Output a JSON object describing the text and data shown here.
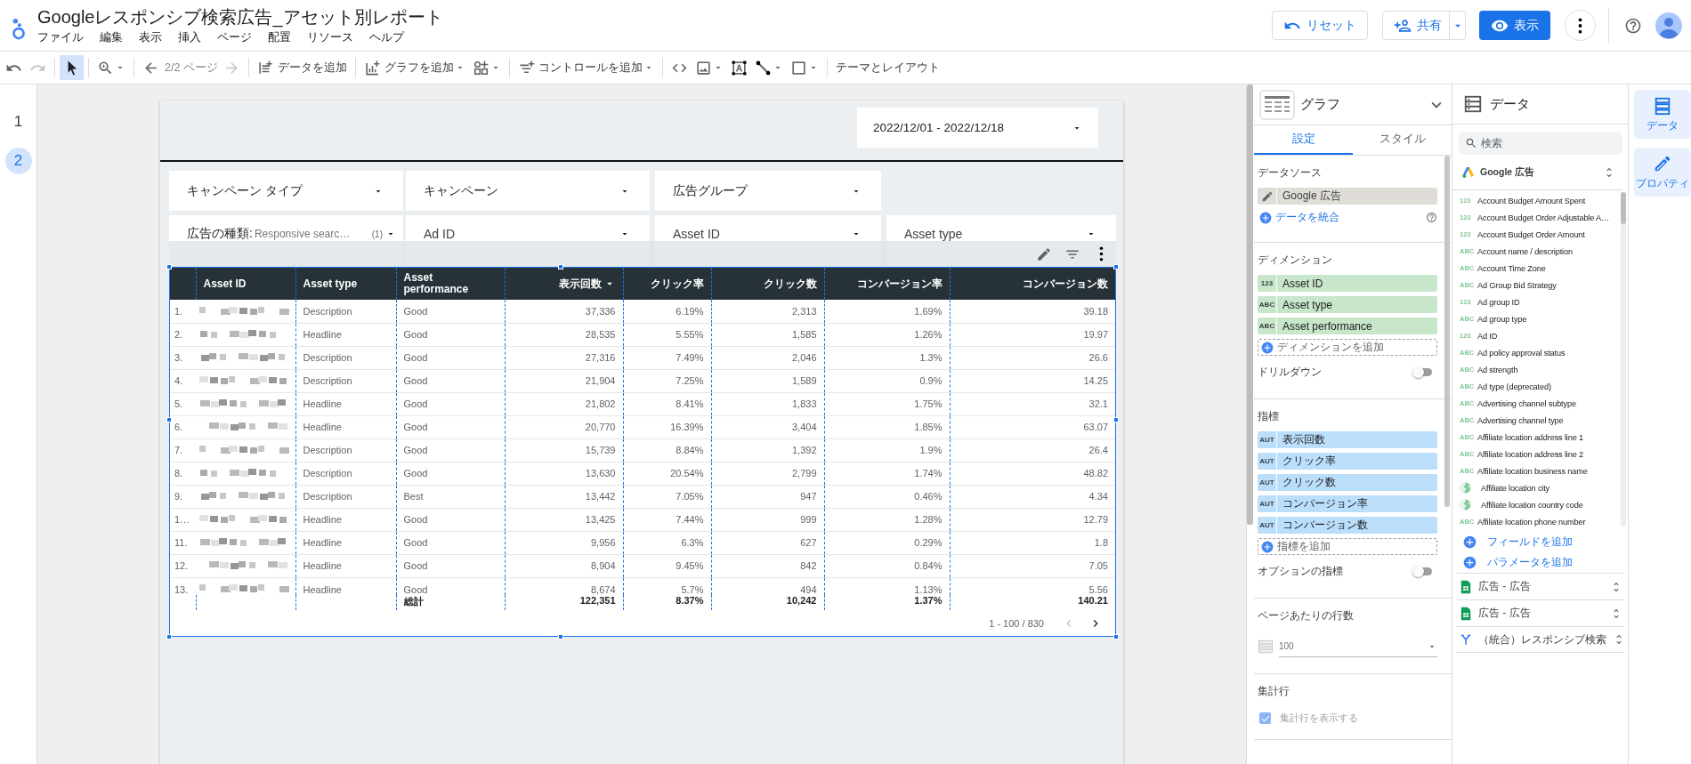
{
  "header": {
    "title": "Googleレスポンシブ検索広告_アセット別レポート",
    "menus": [
      "ファイル",
      "編集",
      "表示",
      "挿入",
      "ページ",
      "配置",
      "リソース",
      "ヘルプ"
    ],
    "reset": "リセット",
    "share": "共有",
    "view": "表示"
  },
  "toolbar": {
    "groups": [
      [
        {
          "kind": "undo",
          "selected": false
        },
        {
          "kind": "redo",
          "selected": false,
          "disabled": true
        }
      ],
      [
        {
          "kind": "select",
          "selected": true
        }
      ],
      [
        {
          "kind": "zoom",
          "selected": false,
          "dropdown": true
        }
      ],
      [
        {
          "kind": "back",
          "selected": false
        },
        {
          "kind": "page",
          "label": "2/2 ページ",
          "selected": false,
          "disabled": true
        },
        {
          "kind": "forward",
          "selected": false,
          "disabled": true
        }
      ],
      [
        {
          "kind": "add_data",
          "label": "データを追加",
          "selected": false
        }
      ],
      [
        {
          "kind": "add_chart",
          "label": "グラフを追加",
          "selected": false,
          "dropdown": true
        },
        {
          "kind": "component",
          "selected": false,
          "dropdown": true
        }
      ],
      [
        {
          "kind": "add_control",
          "label": "コントロールを追加",
          "selected": false,
          "dropdown": true
        }
      ],
      [
        {
          "kind": "code",
          "selected": false
        },
        {
          "kind": "image",
          "selected": false,
          "dropdown": true
        },
        {
          "kind": "textbox",
          "selected": false
        },
        {
          "kind": "line",
          "selected": false,
          "dropdown": true
        },
        {
          "kind": "shape",
          "selected": false,
          "dropdown": true
        }
      ],
      [
        {
          "kind": "theme",
          "label": "テーマとレイアウト",
          "selected": false
        }
      ]
    ]
  },
  "pages": [
    {
      "label": "1",
      "selected": false
    },
    {
      "label": "2",
      "selected": true
    }
  ],
  "report": {
    "date_range": "2022/12/01 - 2022/12/18",
    "filters": [
      [
        {
          "label": "キャンペーン タイプ"
        },
        {
          "label": "キャンペーン"
        },
        {
          "label": "広告グループ"
        }
      ],
      [
        {
          "label": "広告の種類:",
          "value": "Responsive searc…",
          "count": "(1)"
        },
        {
          "label": "Ad ID"
        },
        {
          "label": "Asset ID"
        },
        {
          "label": "Asset type"
        }
      ]
    ],
    "table": {
      "columns": [
        {
          "label": "Asset ID",
          "kind": "dimension",
          "sorted": false
        },
        {
          "label": "Asset type",
          "kind": "dimension",
          "sorted": false
        },
        {
          "label": "Asset performance",
          "kind": "dimension",
          "sorted": false
        },
        {
          "label": "表示回数",
          "kind": "metric",
          "sorted": true
        },
        {
          "label": "クリック率",
          "kind": "metric",
          "sorted": false
        },
        {
          "label": "クリック数",
          "kind": "metric",
          "sorted": false
        },
        {
          "label": "コンバージョン率",
          "kind": "metric",
          "sorted": false
        },
        {
          "label": "コンバージョン数",
          "kind": "metric",
          "sorted": false
        }
      ],
      "rows": [
        {
          "number": "1.",
          "cells": [
            null,
            "Description",
            "Good",
            "37,336",
            "6.19%",
            "2,313",
            "1.69%",
            "39.18"
          ]
        },
        {
          "number": "2.",
          "cells": [
            null,
            "Headline",
            "Good",
            "28,535",
            "5.55%",
            "1,585",
            "1.26%",
            "19.97"
          ]
        },
        {
          "number": "3.",
          "cells": [
            null,
            "Description",
            "Good",
            "27,316",
            "7.49%",
            "2,046",
            "1.3%",
            "26.6"
          ]
        },
        {
          "number": "4.",
          "cells": [
            null,
            "Description",
            "Good",
            "21,904",
            "7.25%",
            "1,589",
            "0.9%",
            "14.25"
          ]
        },
        {
          "number": "5.",
          "cells": [
            null,
            "Headline",
            "Good",
            "21,802",
            "8.41%",
            "1,833",
            "1.75%",
            "32.1"
          ]
        },
        {
          "number": "6.",
          "cells": [
            null,
            "Headline",
            "Good",
            "20,770",
            "16.39%",
            "3,404",
            "1.85%",
            "63.07"
          ]
        },
        {
          "number": "7.",
          "cells": [
            null,
            "Description",
            "Good",
            "15,739",
            "8.84%",
            "1,392",
            "1.9%",
            "26.4"
          ]
        },
        {
          "number": "8.",
          "cells": [
            null,
            "Description",
            "Good",
            "13,630",
            "20.54%",
            "2,799",
            "1.74%",
            "48.82"
          ]
        },
        {
          "number": "9.",
          "cells": [
            null,
            "Description",
            "Best",
            "13,442",
            "7.05%",
            "947",
            "0.46%",
            "4.34"
          ]
        },
        {
          "number": "1…",
          "cells": [
            null,
            "Headline",
            "Good",
            "13,425",
            "7.44%",
            "999",
            "1.28%",
            "12.79"
          ]
        },
        {
          "number": "11.",
          "cells": [
            null,
            "Headline",
            "Good",
            "9,956",
            "6.3%",
            "627",
            "0.29%",
            "1.8"
          ]
        },
        {
          "number": "12.",
          "cells": [
            null,
            "Headline",
            "Good",
            "8,904",
            "9.45%",
            "842",
            "0.84%",
            "7.05"
          ]
        },
        {
          "number": "13.",
          "cells": [
            null,
            "Headline",
            "Good",
            "8,674",
            "5.7%",
            "494",
            "1.13%",
            "5.56"
          ]
        }
      ],
      "totals": {
        "label": "総計",
        "values": [
          "122,351",
          "8.37%",
          "10,242",
          "1.37%",
          "140.21"
        ]
      },
      "pagination": "1 - 100 / 830"
    }
  },
  "properties": {
    "title": "グラフ",
    "tabs": [
      {
        "label": "設定",
        "selected": true
      },
      {
        "label": "スタイル",
        "selected": false
      }
    ],
    "data_source": {
      "heading": "データソース",
      "source": "Google 広告",
      "blend": "データを統合"
    },
    "dimensions": {
      "heading": "ディメンション",
      "items": [
        {
          "type": "123",
          "label": "Asset ID"
        },
        {
          "type": "ABC",
          "label": "Asset type"
        },
        {
          "type": "ABC",
          "label": "Asset performance"
        }
      ],
      "add": "ディメンションを追加",
      "drilldown": {
        "label": "ドリルダウン",
        "on": false
      }
    },
    "metrics": {
      "heading": "指標",
      "items": [
        {
          "type": "AUT",
          "label": "表示回数"
        },
        {
          "type": "AUT",
          "label": "クリック率"
        },
        {
          "type": "AUT",
          "label": "クリック数"
        },
        {
          "type": "AUT",
          "label": "コンバージョン率"
        },
        {
          "type": "AUT",
          "label": "コンバージョン数"
        }
      ],
      "add": "指標を追加",
      "optional": {
        "label": "オプションの指標",
        "on": false
      }
    },
    "rows_per_page": {
      "heading": "ページあたりの行数",
      "value": "100"
    },
    "summary": {
      "heading": "集計行",
      "checkbox": {
        "label": "集計行を表示する",
        "checked": true
      }
    }
  },
  "data_panel": {
    "title": "データ",
    "search": {
      "placeholder": "検索"
    },
    "source": "Google 広告",
    "fields": [
      {
        "kind": "number",
        "type": "123",
        "label": "Account Budget Amount Spent"
      },
      {
        "kind": "number",
        "type": "123",
        "label": "Account Budget Order Adjustable A…"
      },
      {
        "kind": "number",
        "type": "123",
        "label": "Account Budget Order Amount"
      },
      {
        "kind": "text",
        "type": "ABC",
        "label": "Account name / description"
      },
      {
        "kind": "text",
        "type": "ABC",
        "label": "Account Time Zone"
      },
      {
        "kind": "text",
        "type": "ABC",
        "label": "Ad Group Bid Strategy"
      },
      {
        "kind": "number",
        "type": "123",
        "label": "Ad group ID"
      },
      {
        "kind": "text",
        "type": "ABC",
        "label": "Ad group type"
      },
      {
        "kind": "number",
        "type": "123",
        "label": "Ad ID"
      },
      {
        "kind": "text",
        "type": "ABC",
        "label": "Ad policy approval status"
      },
      {
        "kind": "text",
        "type": "ABC",
        "label": "Ad strength"
      },
      {
        "kind": "text",
        "type": "ABC",
        "label": "Ad type (deprecated)"
      },
      {
        "kind": "text",
        "type": "ABC",
        "label": "Advertising channel subtype"
      },
      {
        "kind": "text",
        "type": "ABC",
        "label": "Advertising channel type"
      },
      {
        "kind": "text",
        "type": "ABC",
        "label": "Affiliate location address line 1"
      },
      {
        "kind": "text",
        "type": "ABC",
        "label": "Affiliate location address line 2"
      },
      {
        "kind": "text",
        "type": "ABC",
        "label": "Affiliate location business name"
      },
      {
        "kind": "geo",
        "label": "Affiliate location city"
      },
      {
        "kind": "geo",
        "label": "Affiliate location country code"
      },
      {
        "kind": "text",
        "type": "ABC",
        "label": "Affiliate location phone number"
      }
    ],
    "add_field": "フィールドを追加",
    "add_parameter": "パラメータを追加",
    "sources": [
      {
        "kind": "sheet",
        "label": "広告 - 広告"
      },
      {
        "kind": "sheet",
        "label": "広告 - 広告"
      },
      {
        "kind": "blend",
        "label": "（統合）レスポンシブ検索"
      }
    ]
  },
  "rail": [
    {
      "kind": "data",
      "label": "データ"
    },
    {
      "kind": "properties",
      "label": "プロパティ"
    }
  ]
}
